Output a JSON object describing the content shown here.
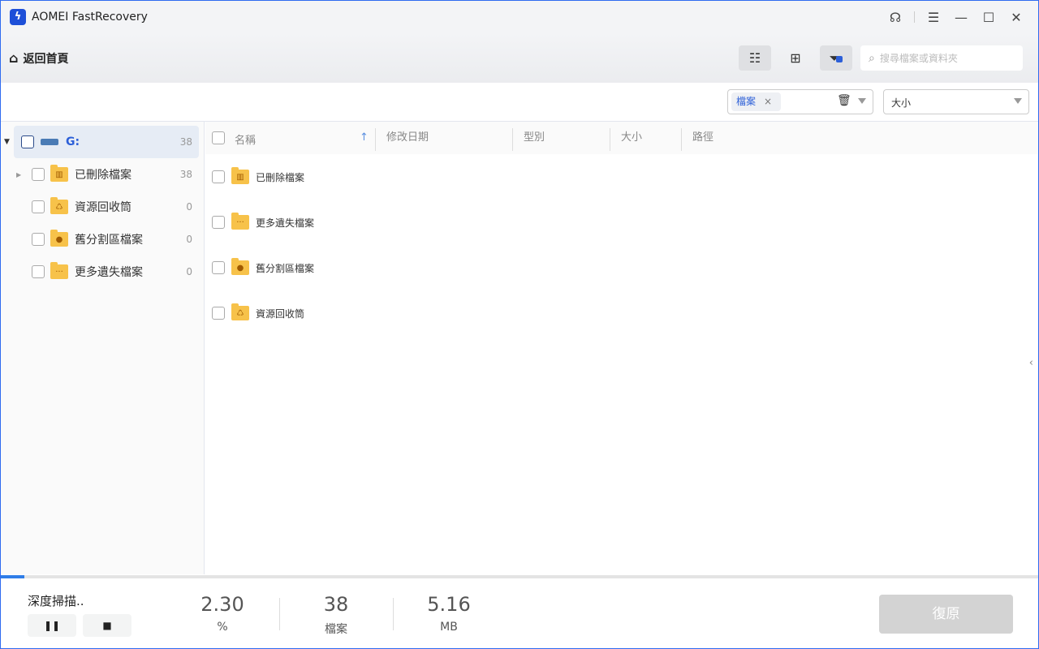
{
  "app": {
    "title": "AOMEI FastRecovery"
  },
  "toolbar": {
    "home_label": "返回首頁",
    "search_placeholder": "搜尋檔案或資料夾"
  },
  "filters": {
    "type_chip": "檔案",
    "size_select": "大小"
  },
  "tree": {
    "drive": {
      "label": "G:",
      "count": "38"
    },
    "items": [
      {
        "label": "已刪除檔案",
        "count": "38",
        "icon": "trash"
      },
      {
        "label": "資源回收筒",
        "count": "0",
        "icon": "recycle"
      },
      {
        "label": "舊分割區檔案",
        "count": "0",
        "icon": "clock"
      },
      {
        "label": "更多遺失檔案",
        "count": "0",
        "icon": "dots"
      }
    ]
  },
  "table": {
    "columns": [
      "名稱",
      "修改日期",
      "型別",
      "大小",
      "路徑"
    ],
    "rows": [
      {
        "name": "已刪除檔案",
        "icon": "trash"
      },
      {
        "name": "更多遺失檔案",
        "icon": "dots"
      },
      {
        "name": "舊分割區檔案",
        "icon": "clock"
      },
      {
        "name": "資源回收筒",
        "icon": "recycle"
      }
    ]
  },
  "footer": {
    "status": "深度掃描..",
    "progress_percent": 2.3,
    "percent": "2.30",
    "percent_unit": "%",
    "files": "38",
    "files_unit": "檔案",
    "size": "5.16",
    "size_unit": "MB",
    "restore_label": "復原"
  },
  "colors": {
    "accent": "#2f6bf0",
    "folder": "#f7c24a"
  }
}
